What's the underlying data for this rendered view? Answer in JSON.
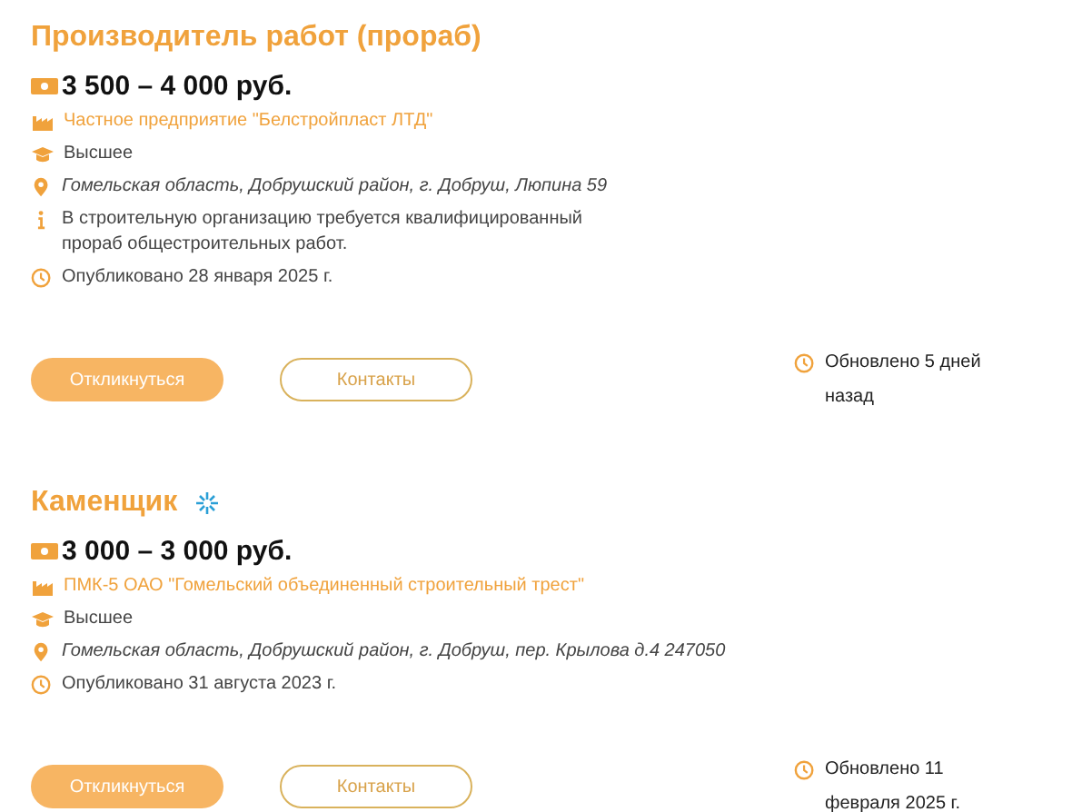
{
  "vacancies": [
    {
      "title": "Производитель работ (прораб)",
      "featured": false,
      "salary": "3 500 – 4 000 руб.",
      "details": [
        {
          "kind": "company",
          "text": "Частное предприятие \"Белстройпласт ЛТД\""
        },
        {
          "kind": "education",
          "text": "Высшее"
        },
        {
          "kind": "location",
          "text": "Гомельская область, Добрушский район, г. Добруш, Люпина 59"
        },
        {
          "kind": "description",
          "text": "В строительную организацию требуется квалифицированный прораб общестроительных работ."
        },
        {
          "kind": "published",
          "text": "Опубликовано 28 января 2025 г."
        }
      ],
      "respond": "Откликнуться",
      "contacts": "Контакты",
      "updated": "Обновлено 5 дней назад"
    },
    {
      "title": "Каменщик",
      "featured": true,
      "salary": "3 000 – 3 000 руб.",
      "details": [
        {
          "kind": "company",
          "text": "ПМК-5 ОАО \"Гомельский объединенный строительный трест\""
        },
        {
          "kind": "education",
          "text": "Высшее"
        },
        {
          "kind": "location",
          "text": "Гомельская область, Добрушский район, г. Добруш, пер. Крылова д.4 247050"
        },
        {
          "kind": "published",
          "text": "Опубликовано 31 августа 2023 г."
        }
      ],
      "respond": "Откликнуться",
      "contacts": "Контакты",
      "updated": "Обновлено 11 февраля 2025 г."
    }
  ]
}
